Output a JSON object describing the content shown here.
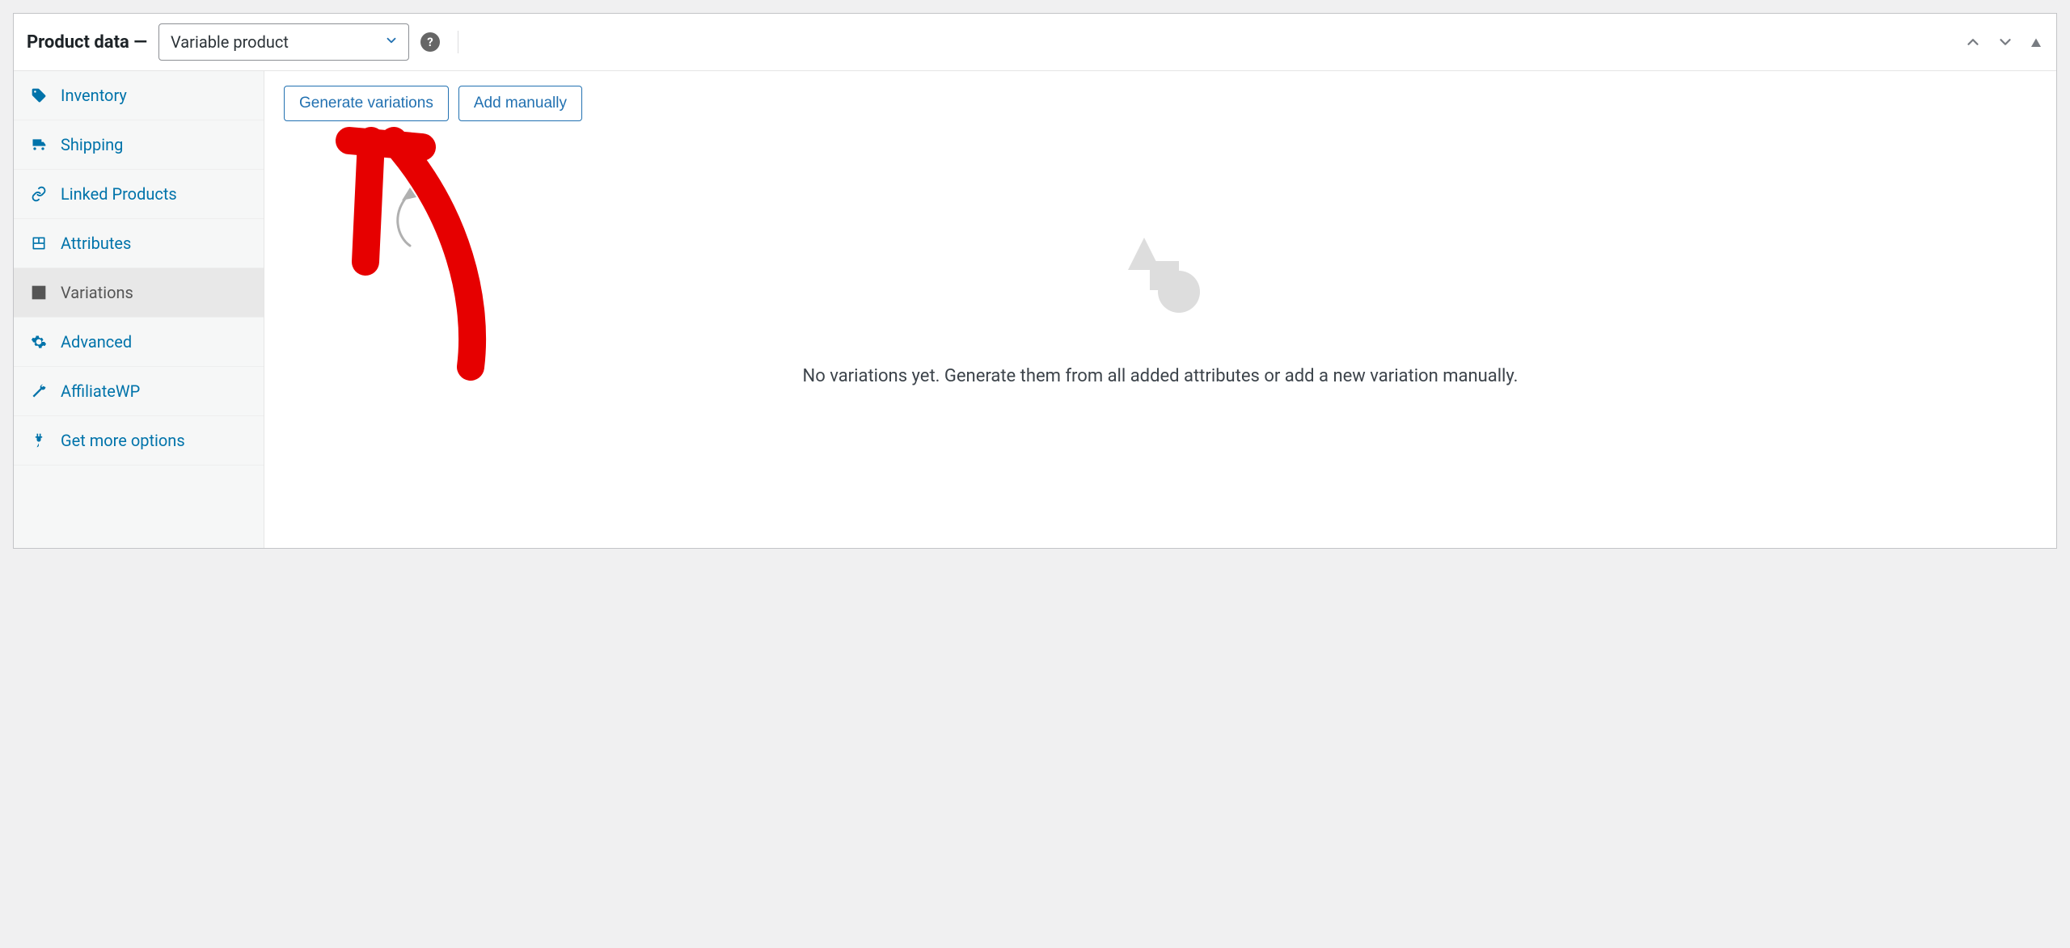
{
  "header": {
    "title": "Product data —",
    "product_type": "Variable product"
  },
  "sidebar": {
    "items": [
      {
        "label": "Inventory"
      },
      {
        "label": "Shipping"
      },
      {
        "label": "Linked Products"
      },
      {
        "label": "Attributes"
      },
      {
        "label": "Variations"
      },
      {
        "label": "Advanced"
      },
      {
        "label": "AffiliateWP"
      },
      {
        "label": "Get more options"
      }
    ]
  },
  "actions": {
    "generate": "Generate variations",
    "add_manual": "Add manually"
  },
  "empty_state": {
    "message": "No variations yet. Generate them from all added attributes or add a new variation manually."
  }
}
